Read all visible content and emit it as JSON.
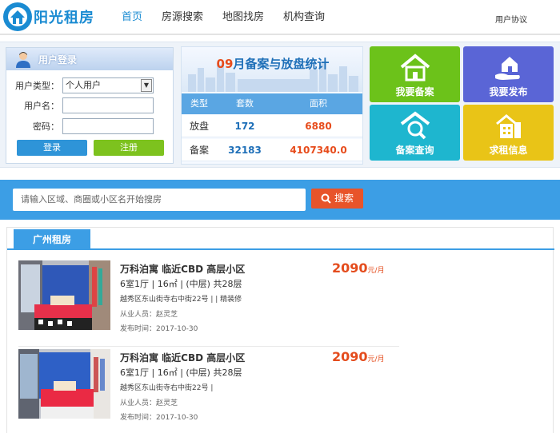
{
  "header": {
    "logo_text": "阳光租房",
    "nav": [
      "首页",
      "房源搜索",
      "地图找房",
      "机构查询"
    ],
    "agreement": "用户协议"
  },
  "login": {
    "title": "用户登录",
    "type_label": "用户类型：",
    "type_value": "个人用户",
    "username_label": "用户名：",
    "password_label": "密码：",
    "login_button": "登录",
    "register_button": "注册"
  },
  "stats": {
    "month": "09",
    "title_rest": "月备案与放盘统计",
    "headers": [
      "类型",
      "套数",
      "面积"
    ],
    "rows": [
      {
        "type": "放盘",
        "count": "172",
        "area": "6880"
      },
      {
        "type": "备案",
        "count": "32183",
        "area": "4107340.0"
      }
    ]
  },
  "tiles": {
    "t1": "我要备案",
    "t2": "我要发布",
    "t3": "备案查询",
    "t4": "求租信息"
  },
  "search": {
    "placeholder": "请输入区域、商圈或小区名开始搜房",
    "button": "搜索"
  },
  "city_tab": "广州租房",
  "listings": [
    {
      "title": "万科泊寓 临近CBD 高层小区",
      "layout": "6室1厅 | 16㎡ | (中层) 共28层",
      "address": "越秀区东山街寺右中街22号 | | 精装修",
      "agent": "从业人员：赵灵芝",
      "date": "发布时间：2017-10-30",
      "price": "2090",
      "unit": "元/月"
    },
    {
      "title": "万科泊寓 临近CBD 高层小区",
      "layout": "6室1厅 | 16㎡ | (中层) 共28层",
      "address": "越秀区东山街寺右中街22号 |",
      "agent": "从业人员：赵灵芝",
      "date": "发布时间：2017-10-30",
      "price": "2090",
      "unit": "元/月"
    }
  ],
  "colors": {
    "brand": "#1a8bd2",
    "price": "#e44c1d",
    "search_bar": "#3c9ee5"
  }
}
